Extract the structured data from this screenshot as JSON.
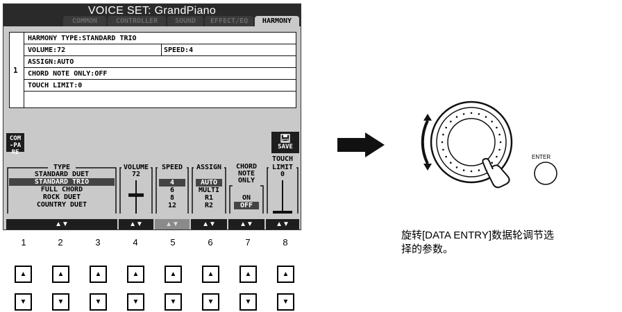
{
  "lcd": {
    "title": "VOICE SET: GrandPiano",
    "tabs": [
      "COMMON",
      "CONTROLLER",
      "SOUND",
      "EFFECT/EQ",
      "HARMONY"
    ],
    "panel": {
      "index": "1",
      "rows": {
        "harmony_type": "HARMONY TYPE:STANDARD TRIO",
        "volume": "VOLUME:72",
        "speed": "SPEED:4",
        "assign": "ASSIGN:AUTO",
        "chord_note_only": "CHORD NOTE ONLY:OFF",
        "touch_limit": "TOUCH LIMIT:0"
      }
    },
    "compare_label": "COM-PARE",
    "save_label": "SAVE",
    "touch_header": "TOUCH",
    "type": {
      "header": "TYPE",
      "options": [
        "STANDARD DUET",
        "STANDARD TRIO",
        "FULL CHORD",
        "ROCK DUET",
        "COUNTRY DUET"
      ],
      "selected": "STANDARD TRIO"
    },
    "volume": {
      "header": "VOLUME",
      "value": "72",
      "level": 0.57
    },
    "speed": {
      "header": "SPEED",
      "options": [
        "4",
        "6",
        "8",
        "12"
      ],
      "selected": "4"
    },
    "assign": {
      "header": "ASSIGN",
      "options": [
        "AUTO",
        "MULTI",
        "R1",
        "R2"
      ],
      "selected": "AUTO"
    },
    "chord_note_only": {
      "header_line1": "CHORD",
      "header_line2": "NOTE",
      "header_line3": "ONLY",
      "options": [
        "ON",
        "OFF"
      ],
      "selected": "OFF"
    },
    "touch_limit": {
      "header": "LIMIT",
      "value": "0",
      "level": 0.0
    },
    "strip_label": "▲▼"
  },
  "buttons": {
    "numbers": [
      "1",
      "2",
      "3",
      "4",
      "5",
      "6",
      "7",
      "8"
    ],
    "up_glyph": "▲",
    "down_glyph": "▼"
  },
  "dial": {
    "enter_label": "ENTER",
    "caption_line1": "旋转[DATA ENTRY]数据轮调节选",
    "caption_line2": "择的参数。"
  }
}
